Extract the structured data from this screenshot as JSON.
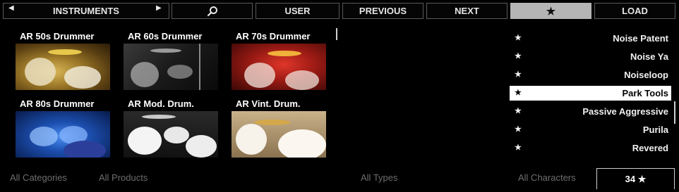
{
  "toolbar": {
    "instruments_label": "INSTRUMENTS",
    "left_arrow": "◀",
    "right_arrow": "▶",
    "user_label": "USER",
    "previous_label": "PREVIOUS",
    "next_label": "NEXT",
    "favorites_glyph": "★",
    "load_label": "LOAD"
  },
  "products": [
    {
      "name": "AR 50s Drummer"
    },
    {
      "name": "AR 60s Drummer"
    },
    {
      "name": "AR 70s Drummer"
    },
    {
      "name": "AR 80s Drummer"
    },
    {
      "name": "AR Mod. Drum."
    },
    {
      "name": "AR Vint. Drum."
    }
  ],
  "presets": [
    {
      "star": "★",
      "label": "Noise Patent"
    },
    {
      "star": "★",
      "label": "Noise Ya"
    },
    {
      "star": "★",
      "label": "Noiseloop"
    },
    {
      "star": "★",
      "label": "Park Tools"
    },
    {
      "star": "★",
      "label": "Passive Aggressive"
    },
    {
      "star": "★",
      "label": "Purila"
    },
    {
      "star": "★",
      "label": "Revered"
    }
  ],
  "selected_preset": "Park Tools",
  "filters": {
    "categories": "All Categories",
    "products": "All Products",
    "types": "All Types",
    "characters": "All Characters"
  },
  "result_count": "34 ★",
  "colors": {
    "background": "#000000",
    "active_button": "#b5b5b5",
    "selected_row": "#ffffff",
    "muted_text": "#6e6e6e"
  }
}
